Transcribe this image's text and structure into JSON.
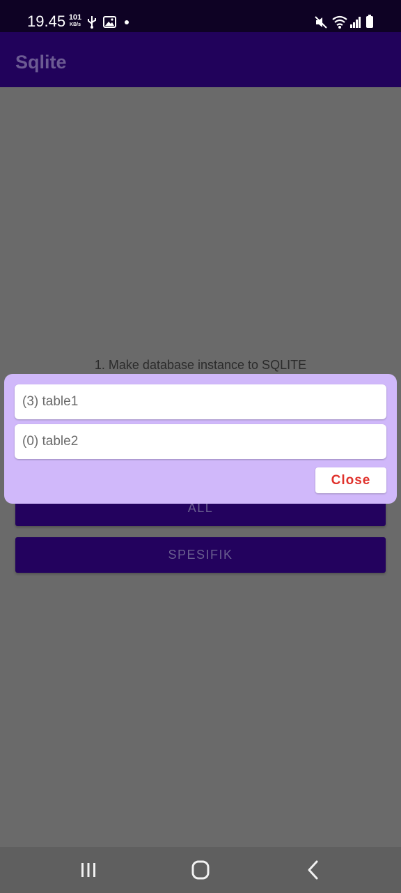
{
  "status_bar": {
    "time": "19.45",
    "net_speed_value": "101",
    "net_speed_unit": "KB/s",
    "icons": [
      "usb-icon",
      "image-icon",
      "notification-dot-icon",
      "mute-icon",
      "wifi-icon",
      "signal-icon",
      "battery-icon"
    ]
  },
  "app_bar": {
    "title": "Sqlite"
  },
  "content": {
    "instruction": "1. Make database instance to SQLITE",
    "buttons": {
      "all": "ALL",
      "spesifik": "SPESIFIK"
    }
  },
  "dialog": {
    "items": [
      {
        "label": "(3) table1"
      },
      {
        "label": "(0) table2"
      }
    ],
    "close_label": "Close"
  },
  "nav_bar": {
    "icons": [
      "recents-icon",
      "home-icon",
      "back-icon"
    ]
  },
  "colors": {
    "status_bar": "#0e0224",
    "app_bar": "#21025b",
    "primary_button": "#23025e",
    "dialog_background": "#d0b8fa",
    "close_text": "#e0322c",
    "scrim": "#6a6a6a"
  }
}
